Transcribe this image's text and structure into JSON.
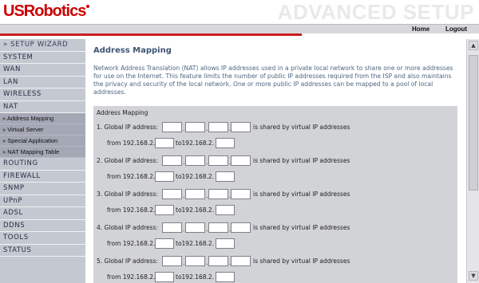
{
  "header": {
    "logo": "USRobotics",
    "section_title": "ADVANCED SETUP",
    "nav": [
      "Home",
      "Logout"
    ]
  },
  "sidebar": {
    "wizard": "» SETUP WIZARD",
    "items_top": [
      "SYSTEM",
      "WAN",
      "LAN",
      "WIRELESS",
      "NAT"
    ],
    "sub_items": [
      "» Address Mapping",
      "» Virtual Server",
      "» Special Application",
      "» NAT Mapping Table"
    ],
    "items_bottom": [
      "ROUTING",
      "FIREWALL",
      "SNMP",
      "UPnP",
      "ADSL",
      "DDNS",
      "TOOLS",
      "STATUS"
    ]
  },
  "main": {
    "title": "Address Mapping",
    "description": "Network Address Translation (NAT) allows IP addresses used in a private local network to share one or more addresses for use on the Internet. This feature limits the number of public IP addresses required from the ISP and also maintains the privacy and security of the local network. One or more public IP addresses can be mapped to a pool of local addresses.",
    "panel_heading": "Address Mapping",
    "global_label_suffix": "Global IP address:",
    "shared_label": "is shared by virtual IP addresses",
    "from_label": "from 192.168.2.",
    "to_label": "to192.168.2.",
    "rows": [
      {
        "num": "1."
      },
      {
        "num": "2."
      },
      {
        "num": "3."
      },
      {
        "num": "4."
      },
      {
        "num": "5."
      }
    ]
  },
  "colors": {
    "brand_red": "#cc0000",
    "title_blue": "#3e5574",
    "sidebar_bg": "#c4c8d1",
    "panel_bg": "#d2d3d6"
  }
}
